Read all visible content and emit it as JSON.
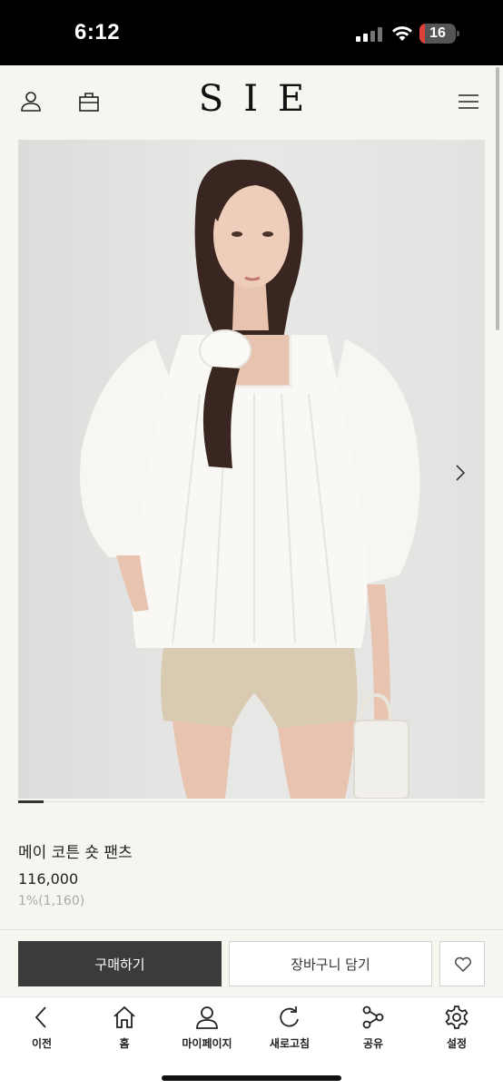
{
  "status_bar": {
    "time": "6:12",
    "battery_level": "16",
    "battery_fraction": 0.16
  },
  "header": {
    "logo": "SIE",
    "icons": [
      "user-icon",
      "bag-icon",
      "menu-icon"
    ]
  },
  "product": {
    "name": "메이 코튼 숏 팬츠",
    "price": "116,000",
    "points": "1%(1,160)",
    "image_index": 1,
    "image_count": 18
  },
  "actions": {
    "buy_label": "구매하기",
    "cart_label": "장바구니 담기",
    "wishlist_icon": "heart-icon"
  },
  "toolbar": {
    "items": [
      {
        "label": "이전",
        "icon": "back-icon"
      },
      {
        "label": "홈",
        "icon": "home-icon"
      },
      {
        "label": "마이페이지",
        "icon": "user-icon"
      },
      {
        "label": "새로고침",
        "icon": "refresh-icon"
      },
      {
        "label": "공유",
        "icon": "share-icon"
      },
      {
        "label": "설정",
        "icon": "gear-icon"
      }
    ]
  },
  "colors": {
    "background": "#f6f5f0",
    "buy_button": "#3b3b3b",
    "battery_low": "#e0403a"
  }
}
